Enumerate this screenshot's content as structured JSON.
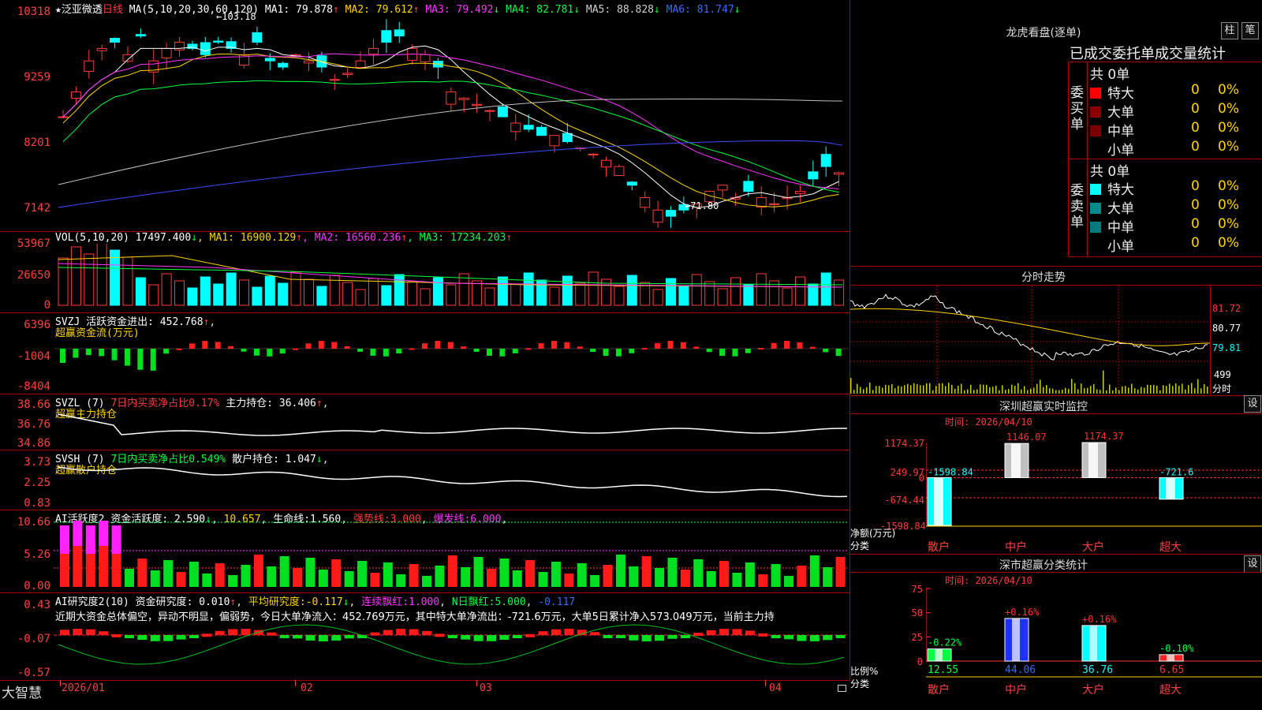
{
  "stock": {
    "name": "泛亚微透",
    "period": "日线",
    "star": "★"
  },
  "main_chart": {
    "y_labels": [
      "10318",
      "9259",
      "8201",
      "7142"
    ],
    "ma_title": "MA(5,10,20,30,60,120)",
    "ma_values": [
      {
        "name": "MA1",
        "value": "79.878",
        "arrow": "↑",
        "color": "#ffffff"
      },
      {
        "name": "MA2",
        "value": "79.612",
        "arrow": "↑",
        "color": "#ffd500"
      },
      {
        "name": "MA3",
        "value": "79.492",
        "arrow": "↓",
        "color": "#ff33ff"
      },
      {
        "name": "MA4",
        "value": "82.781",
        "arrow": "↓",
        "color": "#00ff40"
      },
      {
        "name": "MA5",
        "value": "88.828",
        "arrow": "↓",
        "color": "#d0d0d0"
      },
      {
        "name": "MA6",
        "value": "81.747",
        "arrow": "↓",
        "color": "#3a6bff"
      }
    ],
    "high_label": "←103.18",
    "low_label": "←71.80"
  },
  "vol_chart": {
    "y_labels": [
      "53967",
      "26650",
      "0"
    ],
    "title": "VOL(5,10,20)",
    "value": "17497.400",
    "value_arrow": "↓",
    "ma": [
      {
        "name": "MA1",
        "value": "16900.129",
        "arrow": "↑",
        "color": "#ffd500"
      },
      {
        "name": "MA2",
        "value": "16560.236",
        "arrow": "↑",
        "color": "#ff33ff"
      },
      {
        "name": "MA3",
        "value": "17234.203",
        "arrow": "↑",
        "color": "#00ff40"
      }
    ]
  },
  "svzj": {
    "y_labels": [
      "6396",
      "-1004",
      "-8404"
    ],
    "title": "SVZJ",
    "label": "活跃资金进出:",
    "value": "452.768",
    "arrow": "↑",
    "subtitle": "超赢资金流(万元)"
  },
  "svzl": {
    "y_labels": [
      "38.66",
      "36.76",
      "34.86"
    ],
    "title": "SVZL (7)",
    "ratio_text": "7日内买卖净占比0.17%",
    "label": "主力持仓:",
    "value": "36.406",
    "arrow": "↑",
    "subtitle": "超赢主力持仓"
  },
  "svsh": {
    "y_labels": [
      "3.73",
      "2.25",
      "0.83"
    ],
    "title": "SVSH (7)",
    "ratio_text": "7日内买卖净占比0.549%",
    "label": "散户持仓:",
    "value": "1.047",
    "arrow": "↓",
    "subtitle": "超赢散户持仓"
  },
  "ai_active": {
    "y_labels": [
      "10.66",
      "5.26",
      "0.00"
    ],
    "title": "AI活跃度2",
    "label": "资金活跃度:",
    "value": "2.590",
    "arrow": "↓",
    "v2": "10.657",
    "life_label": "生命线:",
    "life_value": "1.560",
    "strong_label": "强势线:",
    "strong_value": "3.000",
    "burst_label": "爆发线:",
    "burst_value": "6.000"
  },
  "ai_research": {
    "y_labels": [
      "0.43",
      "-0.07",
      "-0.57"
    ],
    "title": "AI研究度2(10)",
    "label": "资金研究度:",
    "value": "0.010",
    "arrow": "↑",
    "avg_label": "平均研究度:",
    "avg_value": "-0.117",
    "avg_arrow": "↓",
    "cont_label": "连续飘红:",
    "cont_value": "1.000",
    "nday_label": "N日飘红:",
    "nday_value": "5.000",
    "last_value": "-0.117",
    "summary": "近期大资金总体偏空，异动不明显，偏弱势，今日大单净流入：452.769万元，其中特大单净流出：-721.6万元，大单5日累计净入573.049万元，当前主力持"
  },
  "x_axis": {
    "labels": [
      "2026/01",
      "02",
      "03",
      "04"
    ]
  },
  "brand": "大智慧",
  "longhu": {
    "title": "龙虎看盘(逐单)",
    "btn_bar": "柱",
    "btn_pen": "笔",
    "subtitle": "已成交委托单成交量统计",
    "buy_label": "委买单",
    "sell_label": "委卖单",
    "buy_total": "共 0单",
    "sell_total": "共 0单",
    "buy_rows": [
      {
        "name": "特大",
        "count": "0",
        "pct": "0%",
        "color": "#ff0000"
      },
      {
        "name": "大单",
        "count": "0",
        "pct": "0%",
        "color": "#8b0000"
      },
      {
        "name": "中单",
        "count": "0",
        "pct": "0%",
        "color": "#7a0000"
      },
      {
        "name": "小单",
        "count": "0",
        "pct": "0%",
        "color": ""
      }
    ],
    "sell_rows": [
      {
        "name": "特大",
        "count": "0",
        "pct": "0%",
        "color": "#00ffff"
      },
      {
        "name": "大单",
        "count": "0",
        "pct": "0%",
        "color": "#008b8b"
      },
      {
        "name": "中单",
        "count": "0",
        "pct": "0%",
        "color": "#007a7a"
      },
      {
        "name": "小单",
        "count": "0",
        "pct": "0%",
        "color": ""
      }
    ]
  },
  "intraday": {
    "title": "分时走势",
    "price_labels": [
      "81.72",
      "80.77",
      "79.81"
    ],
    "vol_label": "499",
    "vol_unit": "分时"
  },
  "sz_monitor": {
    "title": "深圳超赢实时监控",
    "btn": "设",
    "time_label": "时间: 2026/04/10",
    "y_labels": [
      "1174.37",
      "249.97",
      "0",
      "-674.44",
      "-1598.84"
    ],
    "y_unit": "净额(万元)",
    "x_unit": "分类",
    "categories": [
      "散户",
      "中户",
      "大户",
      "超大"
    ]
  },
  "sz_class": {
    "title": "深市超赢分类统计",
    "btn": "设",
    "time_label": "时间: 2026/04/10",
    "y_labels": [
      "75",
      "50",
      "25",
      "0"
    ],
    "y_unit": "比例%",
    "x_unit": "分类",
    "categories": [
      "散户",
      "中户",
      "大户",
      "超大"
    ]
  },
  "chart_data": [
    {
      "type": "bar",
      "title": "深圳超赢实时监控",
      "ylabel": "净额(万元)",
      "xlabel": "分类",
      "categories": [
        "散户",
        "中户",
        "大户",
        "超大"
      ],
      "values": [
        -1598.84,
        1146.07,
        1174.37,
        -721.6
      ],
      "value_labels": [
        "-1598.84",
        "1146.07",
        "1174.37",
        "-721.6"
      ],
      "bar_colors": [
        "#00ffff",
        "#c0c0c0",
        "#c0c0c0",
        "#00ffff"
      ],
      "ylim": [
        -1598.84,
        1174.37
      ]
    },
    {
      "type": "bar",
      "title": "深市超赢分类统计",
      "ylabel": "比例%",
      "xlabel": "分类",
      "categories": [
        "散户",
        "中户",
        "大户",
        "超大"
      ],
      "values": [
        12.55,
        44.06,
        36.76,
        6.65
      ],
      "value_labels": [
        "12.55",
        "44.06",
        "36.76",
        "6.65"
      ],
      "changes": [
        "-0.22%",
        "+0.16%",
        "+0.16%",
        "-0.10%"
      ],
      "bar_colors": [
        "#00ff40",
        "#2030ff",
        "#00ffff",
        "#ff2020"
      ],
      "ylim": [
        0,
        75
      ]
    }
  ]
}
